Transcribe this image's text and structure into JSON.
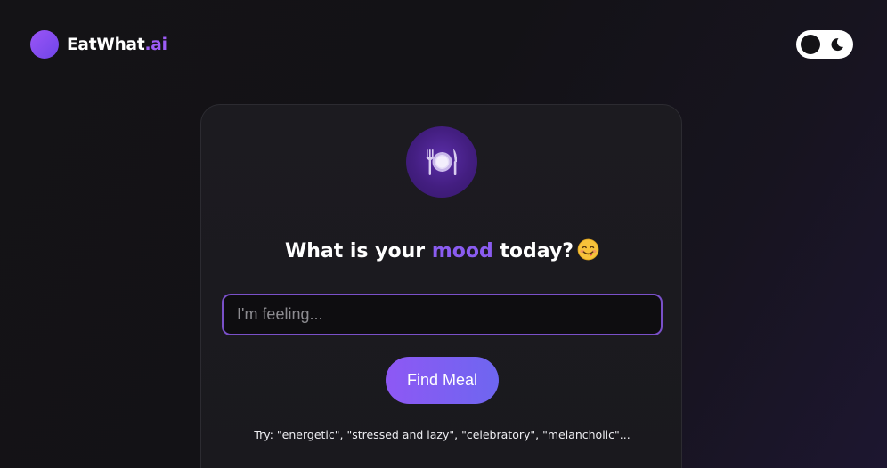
{
  "header": {
    "logo_name": "EatWhat",
    "logo_suffix": ".ai"
  },
  "theme_toggle": {
    "icon": "moon-icon"
  },
  "card": {
    "badge_icon": "plate-with-cutlery-icon",
    "headline_before": "What is your",
    "headline_highlight": "mood",
    "headline_after": "today?",
    "headline_emoji": "face-savoring-food-emoji",
    "input": {
      "value": "",
      "placeholder": "I'm feeling..."
    },
    "button_label": "Find Meal",
    "hint": "Try: \"energetic\", \"stressed and lazy\", \"celebratory\", \"melancholic\"..."
  },
  "colors": {
    "accent": "#8a5cf0",
    "button_start": "#8e58f4",
    "button_end": "#6e66f0",
    "background": "#141316"
  }
}
